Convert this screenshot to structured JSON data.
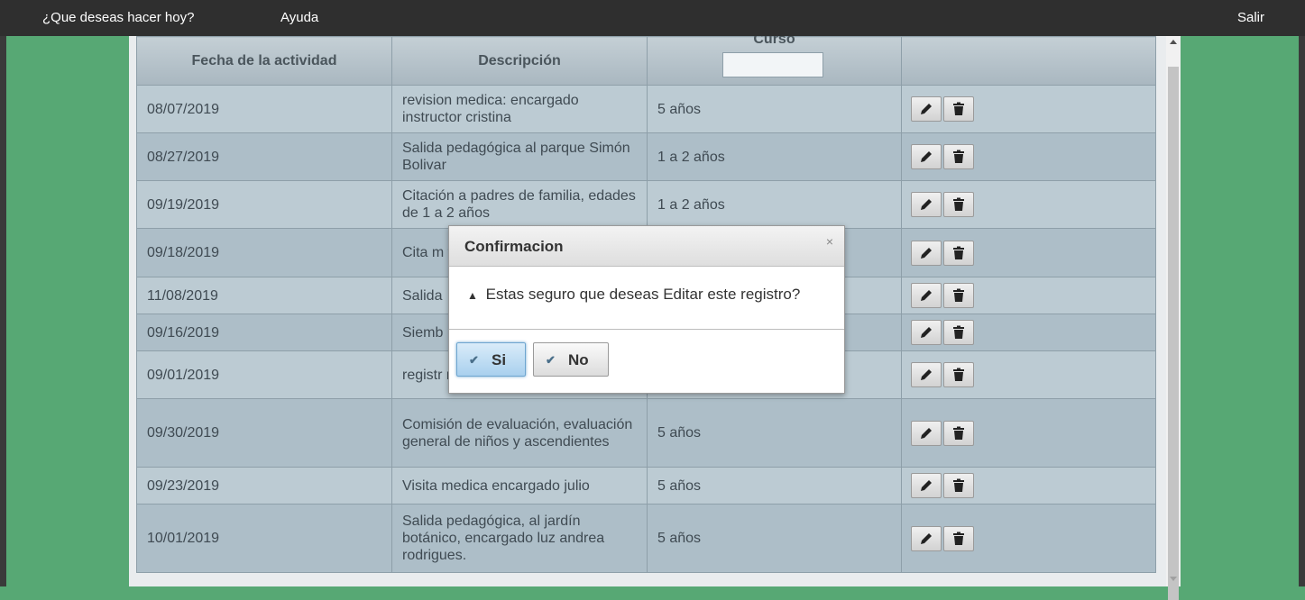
{
  "topbar": {
    "menu_what": "¿Que deseas hacer hoy?",
    "menu_help": "Ayuda",
    "menu_exit": "Salir"
  },
  "table": {
    "headers": [
      "Fecha de la actividad",
      "Descripción",
      "Curso",
      ""
    ],
    "curso_filter_value": "",
    "rows": [
      {
        "fecha": "08/07/2019",
        "descripcion": "revision medica: encargado instructor cristina",
        "curso": "5 años"
      },
      {
        "fecha": "08/27/2019",
        "descripcion": "Salida pedagógica al parque Simón Bolivar",
        "curso": "1 a 2 años"
      },
      {
        "fecha": "09/19/2019",
        "descripcion": "Citación a padres de familia, edades de 1 a 2 años",
        "curso": "1 a 2 años"
      },
      {
        "fecha": "09/18/2019",
        "descripcion": "Cita m fundac",
        "curso": ""
      },
      {
        "fecha": "11/08/2019",
        "descripcion": "Salida",
        "curso": ""
      },
      {
        "fecha": "09/16/2019",
        "descripcion": "Siemb",
        "curso": ""
      },
      {
        "fecha": "09/01/2019",
        "descripcion": "registr matric",
        "curso": ""
      },
      {
        "fecha": "09/30/2019",
        "descripcion": "Comisión de evaluación, evaluación general de niños y ascendientes",
        "curso": "5 años"
      },
      {
        "fecha": "09/23/2019",
        "descripcion": "Visita medica encargado julio",
        "curso": "5 años"
      },
      {
        "fecha": "10/01/2019",
        "descripcion": "Salida pedagógica, al jardín botánico, encargado luz andrea rodrigues.",
        "curso": "5 años"
      }
    ],
    "row_actions": [
      "pencil-icon",
      "trash-icon"
    ]
  },
  "dialog": {
    "title": "Confirmacion",
    "close_glyph": "×",
    "warning_icon": "warning-icon",
    "message": "Estas seguro que deseas Editar este registro?",
    "yes_label": "Si",
    "no_label": "No"
  },
  "colors": {
    "background_green": "#57a874",
    "topbar": "#2f2f2f",
    "header_cell": "#b3c0c8",
    "row_odd": "#bccbd3",
    "row_even": "#adbec8"
  }
}
